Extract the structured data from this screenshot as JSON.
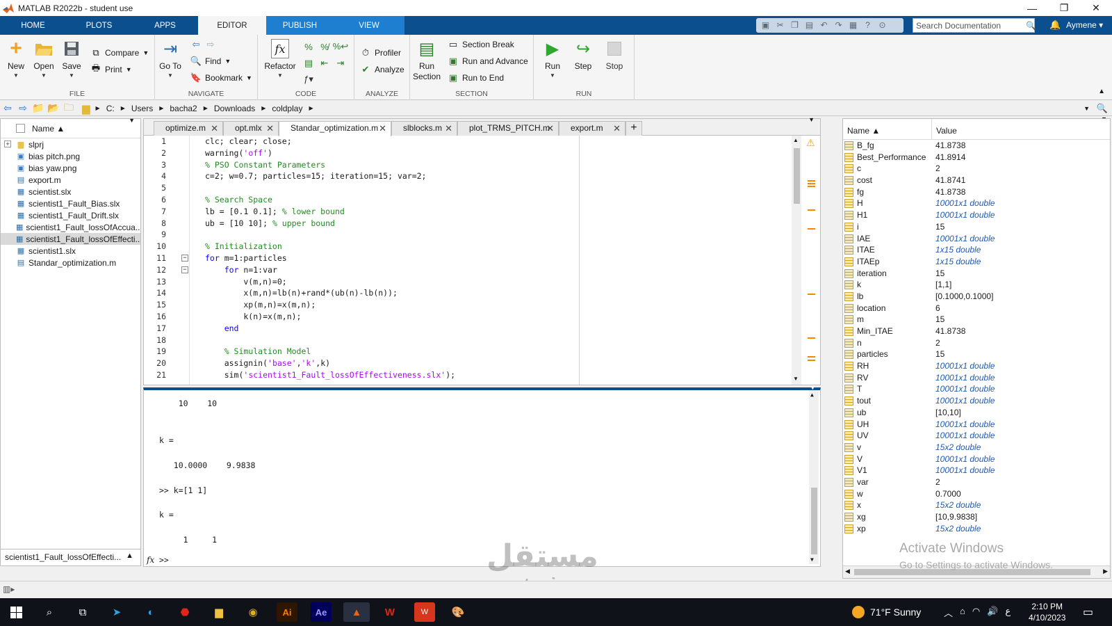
{
  "window": {
    "title": "MATLAB R2022b - student use",
    "controls": [
      "—",
      "❐",
      "✕"
    ]
  },
  "ribbon_tabs": [
    "HOME",
    "PLOTS",
    "APPS",
    "EDITOR",
    "PUBLISH",
    "VIEW"
  ],
  "active_tab": "EDITOR",
  "search_documentation": {
    "placeholder": "Search Documentation"
  },
  "user": "Aymene",
  "groups": {
    "file": {
      "label": "FILE",
      "new": "New",
      "open": "Open",
      "save": "Save",
      "compare": "Compare",
      "print": "Print"
    },
    "navigate": {
      "label": "NAVIGATE",
      "goto": "Go To",
      "find": "Find",
      "bookmark": "Bookmark"
    },
    "code": {
      "label": "CODE",
      "refactor": "Refactor"
    },
    "analyze": {
      "label": "ANALYZE",
      "profiler": "Profiler",
      "analyze": "Analyze"
    },
    "section": {
      "label": "SECTION",
      "run_section": "Run Section",
      "section_break": "Section Break",
      "run_and_advance": "Run and Advance",
      "run_to_end": "Run to End"
    },
    "run": {
      "label": "RUN",
      "run": "Run",
      "step": "Step",
      "stop": "Stop"
    }
  },
  "address_path": [
    "C:",
    "Users",
    "bacha2",
    "Downloads",
    "coldplay"
  ],
  "file_browser": {
    "header": "Name ▲",
    "files": [
      {
        "name": "slprj",
        "icon": "folder-icon"
      },
      {
        "name": "bias pitch.png",
        "icon": "image-file-icon"
      },
      {
        "name": "bias yaw.png",
        "icon": "image-file-icon"
      },
      {
        "name": "export.m",
        "icon": "m-file-icon"
      },
      {
        "name": "scientist.slx",
        "icon": "simulink-file-icon"
      },
      {
        "name": "scientist1_Fault_Bias.slx",
        "icon": "simulink-file-icon"
      },
      {
        "name": "scientist1_Fault_Drift.slx",
        "icon": "simulink-file-icon"
      },
      {
        "name": "scientist1_Fault_lossOfAccua...",
        "icon": "simulink-file-icon"
      },
      {
        "name": "scientist1_Fault_lossOfEffecti...",
        "icon": "simulink-file-icon",
        "selected": true
      },
      {
        "name": "scientist1.slx",
        "icon": "simulink-file-icon"
      },
      {
        "name": "Standar_optimization.m",
        "icon": "m-file-icon"
      }
    ],
    "footer": "scientist1_Fault_lossOfEffecti..."
  },
  "editor_tabs": [
    "optimize.m",
    "opt.mlx",
    "Standar_optimization.m",
    "slblocks.m",
    "plot_TRMS_PITCH.m",
    "export.m"
  ],
  "active_editor_tab": "Standar_optimization.m",
  "code_lines": [
    [
      {
        "t": "clc; clear; close;",
        "c": ""
      }
    ],
    [
      {
        "t": "warning(",
        "c": ""
      },
      {
        "t": "'off'",
        "c": "str"
      },
      {
        "t": ")",
        "c": ""
      }
    ],
    [
      {
        "t": "% PSO Constant Parameters",
        "c": "cm"
      }
    ],
    [
      {
        "t": "c=2; w=0.7; particles=15; iteration=15; var=2;",
        "c": ""
      }
    ],
    [],
    [
      {
        "t": "% Search Space",
        "c": "cm"
      }
    ],
    [
      {
        "t": "lb = [0.1 0.1]; ",
        "c": ""
      },
      {
        "t": "% lower bound",
        "c": "cm"
      }
    ],
    [
      {
        "t": "ub = [10 10]; ",
        "c": ""
      },
      {
        "t": "% upper bound",
        "c": "cm"
      }
    ],
    [],
    [
      {
        "t": "% Initialization",
        "c": "cm"
      }
    ],
    [
      {
        "t": "for",
        "c": "kw"
      },
      {
        "t": " m=1:particles",
        "c": ""
      }
    ],
    [
      {
        "t": "    ",
        "c": ""
      },
      {
        "t": "for",
        "c": "kw"
      },
      {
        "t": " n=1:var",
        "c": ""
      }
    ],
    [
      {
        "t": "        v(m,n)=0;",
        "c": ""
      }
    ],
    [
      {
        "t": "        x(m,n)=lb(n)+rand*(ub(n)-lb(n));",
        "c": ""
      }
    ],
    [
      {
        "t": "        xp(m,n)=x(m,n);",
        "c": ""
      }
    ],
    [
      {
        "t": "        k(n)=x(m,n);",
        "c": ""
      }
    ],
    [
      {
        "t": "    ",
        "c": ""
      },
      {
        "t": "end",
        "c": "kw"
      }
    ],
    [],
    [
      {
        "t": "    ",
        "c": ""
      },
      {
        "t": "% Simulation Model",
        "c": "cm"
      }
    ],
    [
      {
        "t": "    assignin(",
        "c": ""
      },
      {
        "t": "'base'",
        "c": "str"
      },
      {
        "t": ",",
        "c": ""
      },
      {
        "t": "'k'",
        "c": "str"
      },
      {
        "t": ",k)",
        "c": ""
      }
    ],
    [
      {
        "t": "    sim(",
        "c": ""
      },
      {
        "t": "'scientist1_Fault_lossOfEffectiveness.slx'",
        "c": "str"
      },
      {
        "t": ");",
        "c": ""
      }
    ]
  ],
  "command_window": {
    "lines": [
      "    10    10",
      "",
      "",
      "k =",
      "",
      "   10.0000    9.9838",
      "",
      ">> k=[1 1]",
      "",
      "k =",
      "",
      "     1     1"
    ],
    "prompt": ">>",
    "fx": "fx"
  },
  "workspace": {
    "headers": {
      "name": "Name ▲",
      "value": "Value"
    },
    "vars": [
      {
        "name": "B_fg",
        "value": "41.8738",
        "italic": false
      },
      {
        "name": "Best_Performance",
        "value": "41.8914",
        "italic": false
      },
      {
        "name": "c",
        "value": "2",
        "italic": false
      },
      {
        "name": "cost",
        "value": "41.8741",
        "italic": false
      },
      {
        "name": "fg",
        "value": "41.8738",
        "italic": false
      },
      {
        "name": "H",
        "value": "10001x1 double",
        "italic": true
      },
      {
        "name": "H1",
        "value": "10001x1 double",
        "italic": true
      },
      {
        "name": "i",
        "value": "15",
        "italic": false
      },
      {
        "name": "IAE",
        "value": "10001x1 double",
        "italic": true
      },
      {
        "name": "ITAE",
        "value": "1x15 double",
        "italic": true
      },
      {
        "name": "ITAEp",
        "value": "1x15 double",
        "italic": true
      },
      {
        "name": "iteration",
        "value": "15",
        "italic": false
      },
      {
        "name": "k",
        "value": "[1,1]",
        "italic": false
      },
      {
        "name": "lb",
        "value": "[0.1000,0.1000]",
        "italic": false
      },
      {
        "name": "location",
        "value": "6",
        "italic": false
      },
      {
        "name": "m",
        "value": "15",
        "italic": false
      },
      {
        "name": "Min_ITAE",
        "value": "41.8738",
        "italic": false
      },
      {
        "name": "n",
        "value": "2",
        "italic": false
      },
      {
        "name": "particles",
        "value": "15",
        "italic": false
      },
      {
        "name": "RH",
        "value": "10001x1 double",
        "italic": true
      },
      {
        "name": "RV",
        "value": "10001x1 double",
        "italic": true
      },
      {
        "name": "T",
        "value": "10001x1 double",
        "italic": true
      },
      {
        "name": "tout",
        "value": "10001x1 double",
        "italic": true
      },
      {
        "name": "ub",
        "value": "[10,10]",
        "italic": false
      },
      {
        "name": "UH",
        "value": "10001x1 double",
        "italic": true
      },
      {
        "name": "UV",
        "value": "10001x1 double",
        "italic": true
      },
      {
        "name": "v",
        "value": "15x2 double",
        "italic": true
      },
      {
        "name": "V",
        "value": "10001x1 double",
        "italic": true
      },
      {
        "name": "V1",
        "value": "10001x1 double",
        "italic": true
      },
      {
        "name": "var",
        "value": "2",
        "italic": false
      },
      {
        "name": "w",
        "value": "0.7000",
        "italic": false
      },
      {
        "name": "x",
        "value": "15x2 double",
        "italic": true
      },
      {
        "name": "xg",
        "value": "[10,9.9838]",
        "italic": false
      },
      {
        "name": "xp",
        "value": "15x2 double",
        "italic": true
      }
    ]
  },
  "activation": {
    "title": "Activate Windows",
    "sub": "Go to Settings to activate Windows."
  },
  "watermark": {
    "arabic": "مستقل",
    "latin": "mostaqi.com"
  },
  "taskbar": {
    "weather": "71°F  Sunny",
    "time": "2:10 PM",
    "date": "4/10/2023",
    "lang": "ع"
  },
  "colors": {
    "ribbon_blue": "#0b4f8f",
    "tab_accent": "#1e7ed0",
    "keyword": "#0e00ff",
    "string": "#a709f5",
    "comment": "#228b22"
  }
}
